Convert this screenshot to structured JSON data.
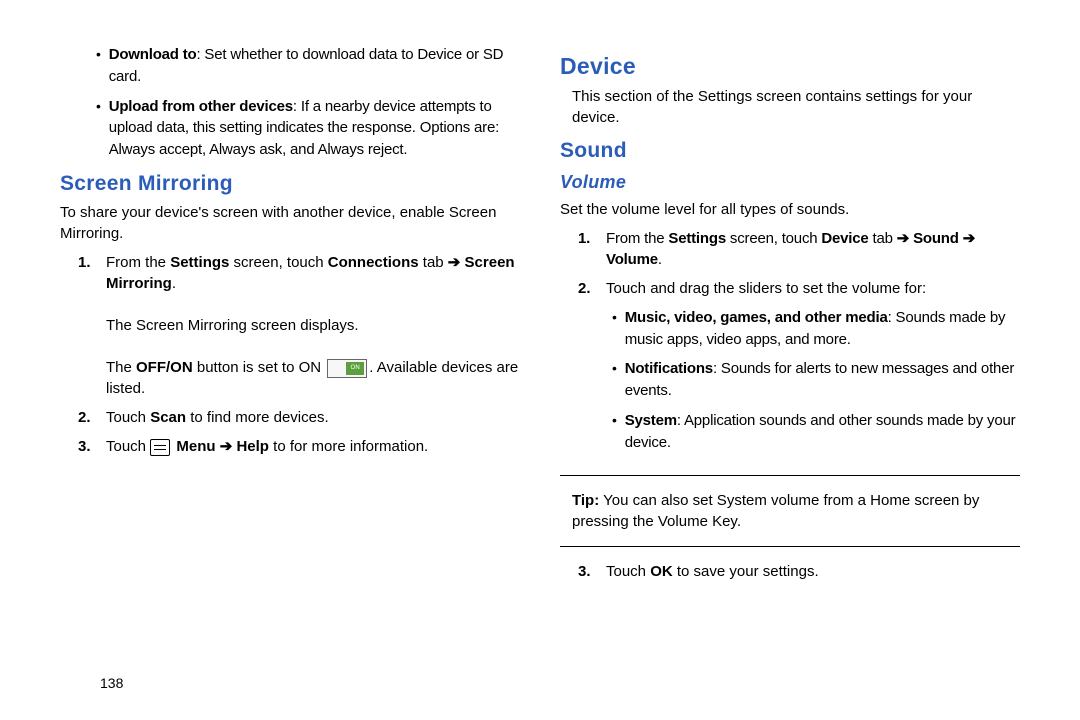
{
  "page_number": "138",
  "left": {
    "bullets": [
      {
        "bold": "Download to",
        "rest": ": Set whether to download data to Device or SD card."
      },
      {
        "bold": "Upload from other devices",
        "rest": ": If a nearby device attempts to upload data, this setting indicates the response. Options are: Always accept, Always ask, and Always reject."
      }
    ],
    "heading": "Screen Mirroring",
    "intro": "To share your device's screen with another device, enable Screen Mirroring.",
    "step1_pre": "From the ",
    "step1_b1": "Settings",
    "step1_mid": " screen, touch ",
    "step1_b2": "Connections",
    "step1_aft": " tab ",
    "arrow": "➔",
    "step1_b3": "Screen Mirroring",
    "step1_line2": "The Screen Mirroring screen displays.",
    "step1_line3_pre": "The ",
    "step1_line3_b": "OFF/ON",
    "step1_line3_mid": " button is set to ON ",
    "step1_line3_aft": ". Available devices are listed.",
    "on_label": "ON",
    "step2_pre": "Touch ",
    "step2_b": "Scan",
    "step2_aft": " to find more devices.",
    "step3_pre": "Touch ",
    "step3_b1": "Menu",
    "step3_b2": "Help",
    "step3_aft": " to for more information."
  },
  "right": {
    "h1": "Device",
    "intro": "This section of the Settings screen contains settings for your device.",
    "h2": "Sound",
    "h3": "Volume",
    "vol_intro": "Set the volume level for all types of sounds.",
    "step1_pre": "From the ",
    "step1_b1": "Settings",
    "step1_mid1": " screen, touch ",
    "step1_b2": "Device",
    "step1_mid2": " tab ",
    "arrow": "➔",
    "step1_b3": "Sound",
    "step1_b4": "Volume",
    "step2": "Touch and drag the sliders to set the volume for:",
    "bullets": [
      {
        "bold": "Music",
        "bold_rest": ", video, games, and other media",
        "rest": ": Sounds made by music apps, video apps, and more."
      },
      {
        "bold": "Notifications",
        "bold_rest": "",
        "rest": ": Sounds for alerts to new messages and other events."
      },
      {
        "bold": "System",
        "bold_rest": "",
        "rest": ": Application sounds and other sounds made by your device."
      }
    ],
    "tip_b": "Tip:",
    "tip_rest": " You can also set System volume from a Home screen by pressing the Volume Key.",
    "step3_pre": "Touch ",
    "step3_b": "OK",
    "step3_aft": " to save your settings."
  }
}
